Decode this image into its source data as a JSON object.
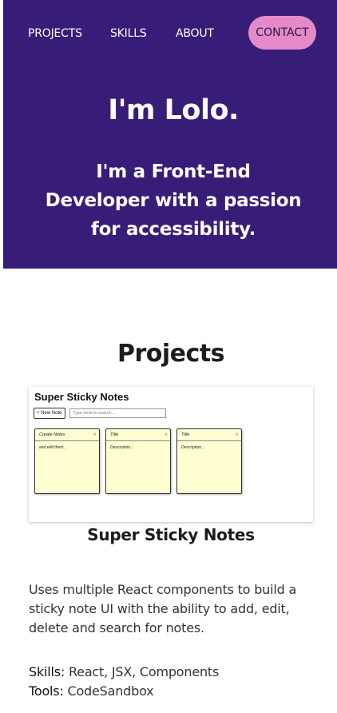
{
  "nav": {
    "projects": "PROJECTS",
    "skills": "SKILLS",
    "about": "ABOUT",
    "contact": "CONTACT"
  },
  "hero": {
    "name": "I'm Lolo.",
    "tagline": "I'm a Front-End Developer with a passion for accessibility."
  },
  "projects": {
    "title": "Projects",
    "items": [
      {
        "screenshot": {
          "app_title": "Super Sticky Notes",
          "new_note_label": "+ New Note",
          "search_placeholder": "Type here to search...",
          "notes": [
            {
              "title": "Create Notes",
              "body": "and edit them..."
            },
            {
              "title": "Title",
              "body": "Description..."
            },
            {
              "title": "Title",
              "body": "Description..."
            }
          ]
        },
        "name": "Super Sticky Notes",
        "description": "Uses multiple React components to build a sticky note UI with the ability to add, edit, delete and search for notes.",
        "skills_label": "Skills:",
        "skills": "React, JSX, Components",
        "tools_label": "Tools:",
        "tools": "CodeSandbox"
      }
    ]
  },
  "colors": {
    "hero_bg": "#381d78",
    "contact_bg": "#e58ac8",
    "note_bg": "#ffffd2"
  }
}
